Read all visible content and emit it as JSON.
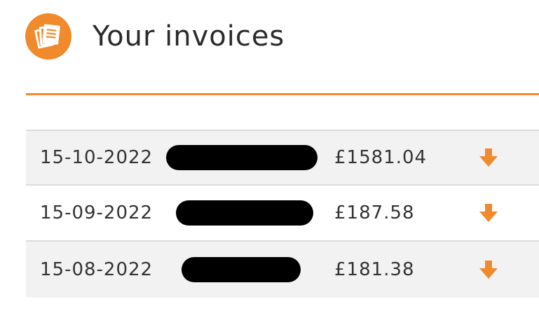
{
  "page": {
    "title": "Your invoices"
  },
  "invoices": [
    {
      "date": "15-10-2022",
      "amount": "£1581.04"
    },
    {
      "date": "15-09-2022",
      "amount": "£187.58"
    },
    {
      "date": "15-08-2022",
      "amount": "£181.38"
    }
  ],
  "icons": {
    "header": "invoice-documents-icon",
    "download": "download-arrow-icon"
  },
  "colors": {
    "accent": "#f08a2c",
    "row_shade": "#f2f2f2",
    "text": "#333333"
  }
}
